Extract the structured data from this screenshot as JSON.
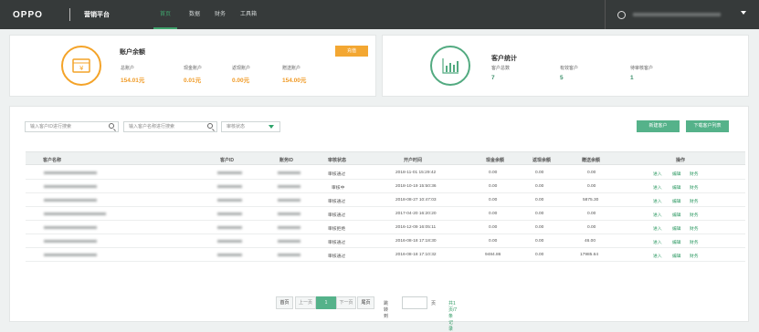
{
  "header": {
    "brand": "oppo",
    "platform": "营销平台",
    "nav": [
      "首页",
      "数据",
      "财务",
      "工具箱"
    ],
    "active_nav": "首页"
  },
  "balance": {
    "title": "账户余额",
    "recharge": "充值",
    "items": [
      {
        "label": "总账户",
        "value": "154.01元"
      },
      {
        "label": "现金账户",
        "value": "0.01元"
      },
      {
        "label": "返现账户",
        "value": "0.00元"
      },
      {
        "label": "赠送账户",
        "value": "154.00元"
      }
    ]
  },
  "stats": {
    "title": "客户统计",
    "items": [
      {
        "label": "客户总数",
        "value": "7"
      },
      {
        "label": "有效客户",
        "value": "5"
      },
      {
        "label": "待审核客户",
        "value": "1"
      }
    ]
  },
  "filters": {
    "id_placeholder": "输入客户ID进行搜索",
    "name_placeholder": "输入客户名称进行搜索",
    "status_select": "审核状态",
    "new_btn": "新建客户",
    "download_btn": "下载客户列表"
  },
  "table": {
    "headers": [
      "客户名称",
      "客户ID",
      "账务ID",
      "审核状态",
      "开户时间",
      "现金余额",
      "返现余额",
      "赠送余额",
      "操作"
    ],
    "rows": [
      {
        "status": "审核通过",
        "time": "2018-11-01 15:29:42",
        "cash": "0.00",
        "rebate": "0.00",
        "gift": "0.00"
      },
      {
        "status": "审核中",
        "time": "2018-10-19 15:50:36",
        "cash": "0.00",
        "rebate": "0.00",
        "gift": "0.00"
      },
      {
        "status": "审核通过",
        "time": "2018-08-27 10:47:03",
        "cash": "0.00",
        "rebate": "0.00",
        "gift": "5875.30"
      },
      {
        "status": "审核通过",
        "time": "2017-04-20 16:20:20",
        "cash": "0.00",
        "rebate": "0.00",
        "gift": "0.00"
      },
      {
        "status": "审核拒绝",
        "time": "2016-12-09 16:05:11",
        "cash": "0.00",
        "rebate": "0.00",
        "gift": "0.00"
      },
      {
        "status": "审核通过",
        "time": "2016-08-18 17:18:30",
        "cash": "0.00",
        "rebate": "0.00",
        "gift": "46.00"
      },
      {
        "status": "审核通过",
        "time": "2016-08-18 17:10:32",
        "cash": "9484.86",
        "rebate": "0.00",
        "gift": "17985.64"
      }
    ],
    "ops": [
      "进入",
      "编辑",
      "财务"
    ]
  },
  "pagination": {
    "first": "首页",
    "prev": "上一页",
    "current": "1",
    "next": "下一页",
    "last": "尾页",
    "jump_label": "跳转到",
    "page_unit": "页",
    "total": "共1页/7条记录"
  }
}
